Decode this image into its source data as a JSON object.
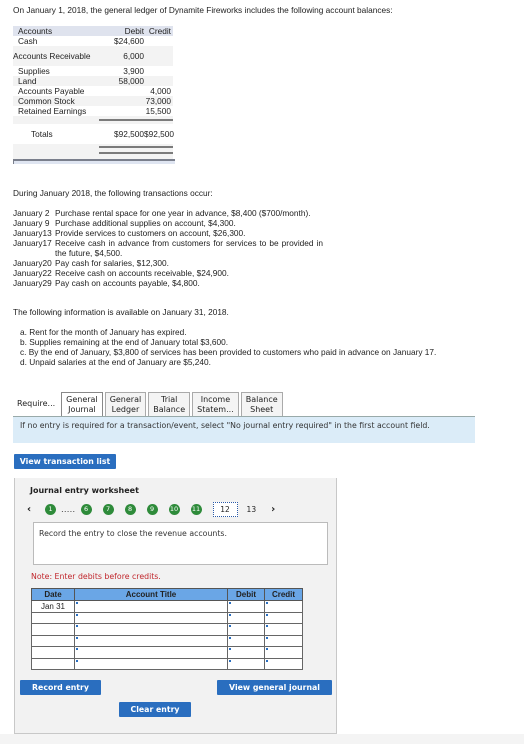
{
  "intro": "On January 1, 2018, the general ledger of Dynamite Fireworks includes the following account balances:",
  "balances": {
    "headers": [
      "Accounts",
      "Debit",
      "Credit"
    ],
    "rows": [
      {
        "account": "Cash",
        "debit": "$24,600",
        "credit": ""
      },
      {
        "account": "Accounts Receivable",
        "debit": "6,000",
        "credit": ""
      },
      {
        "account": "Supplies",
        "debit": "3,900",
        "credit": ""
      },
      {
        "account": "Land",
        "debit": "58,000",
        "credit": ""
      },
      {
        "account": "Accounts Payable",
        "debit": "",
        "credit": "4,000"
      },
      {
        "account": "Common Stock",
        "debit": "",
        "credit": "73,000"
      },
      {
        "account": "Retained Earnings",
        "debit": "",
        "credit": "15,500"
      }
    ],
    "totals": {
      "label": "Totals",
      "debit": "$92,500",
      "credit": "$92,500"
    }
  },
  "during": "During January 2018, the following transactions occur:",
  "transactions": [
    {
      "date": "January 2",
      "desc": "Purchase rental space for one year in advance, $8,400 ($700/month)."
    },
    {
      "date": "January 9",
      "desc": "Purchase additional supplies on account, $4,300."
    },
    {
      "date": "January13",
      "desc": "Provide services to customers on account, $26,300."
    },
    {
      "date": "January17",
      "desc": "Receive cash in advance from customers for services to be provided in the future, $4,500."
    },
    {
      "date": "January20",
      "desc": "Pay cash for salaries, $12,300."
    },
    {
      "date": "January22",
      "desc": "Receive cash on accounts receivable, $24,900."
    },
    {
      "date": "January29",
      "desc": "Pay cash on accounts payable, $4,800."
    }
  ],
  "info_heading": "The following information is available on January 31, 2018.",
  "info_items": [
    "a. Rent for the month of January has expired.",
    "b. Supplies remaining at the end of January total $3,600.",
    "c. By the end of January, $3,800 of services has been provided to customers who paid in advance on January 17.",
    "d. Unpaid salaries at the end of January are $5,240."
  ],
  "tabs": [
    {
      "line1": "Require...",
      "line2": ""
    },
    {
      "line1": "General",
      "line2": "Journal"
    },
    {
      "line1": "General",
      "line2": "Ledger"
    },
    {
      "line1": "Trial",
      "line2": "Balance"
    },
    {
      "line1": "Income",
      "line2": "Statem..."
    },
    {
      "line1": "Balance",
      "line2": "Sheet"
    }
  ],
  "notice": "If no entry is required for a transaction/event, select \"No journal entry required\" in the first account field.",
  "view_transaction_list": "View transaction list",
  "worksheet": {
    "title": "Journal entry worksheet",
    "completed_steps": [
      "1",
      "6",
      "7",
      "8",
      "9",
      "10",
      "11"
    ],
    "ellipsis": ".....",
    "current_step": "12",
    "next_steps": [
      "13"
    ],
    "prompt": "Record the entry to close the revenue accounts.",
    "note": "Note: Enter debits before credits.",
    "columns": [
      "Date",
      "Account Title",
      "Debit",
      "Credit"
    ],
    "rows": [
      {
        "date": "Jan 31",
        "account": "",
        "debit": "",
        "credit": ""
      },
      {
        "date": "",
        "account": "",
        "debit": "",
        "credit": ""
      },
      {
        "date": "",
        "account": "",
        "debit": "",
        "credit": ""
      },
      {
        "date": "",
        "account": "",
        "debit": "",
        "credit": ""
      },
      {
        "date": "",
        "account": "",
        "debit": "",
        "credit": ""
      },
      {
        "date": "",
        "account": "",
        "debit": "",
        "credit": ""
      }
    ],
    "record_entry": "Record entry",
    "view_general_journal": "View general journal",
    "clear_entry": "Clear entry",
    "nav_prev": "‹",
    "nav_next": "›"
  },
  "colors": {
    "button": "#2a6ebf",
    "step_complete": "#2e8b3a",
    "table_header": "#6aa6e6",
    "notice_bg": "#dbecf8",
    "note_red": "#c0262c"
  }
}
